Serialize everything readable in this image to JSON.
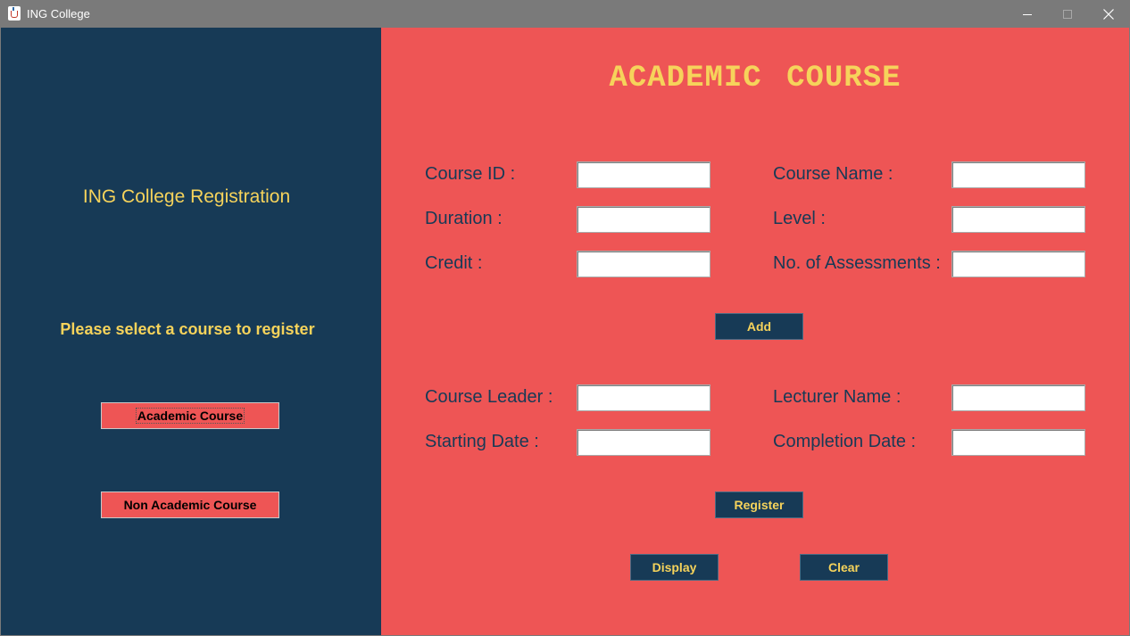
{
  "window": {
    "title": "ING College"
  },
  "sidebar": {
    "title": "ING College Registration",
    "prompt": "Please select a course to register",
    "academic_button": "Academic Course",
    "non_academic_button": "Non Academic Course"
  },
  "form": {
    "heading": "ACADEMIC COURSE",
    "labels": {
      "course_id": "Course ID :",
      "course_name": "Course Name :",
      "duration": "Duration :",
      "level": "Level :",
      "credit": "Credit :",
      "assessments": "No. of Assessments :",
      "course_leader": "Course Leader :",
      "lecturer_name": "Lecturer Name :",
      "starting_date": "Starting Date :",
      "completion_date": "Completion Date :"
    },
    "values": {
      "course_id": "",
      "course_name": "",
      "duration": "",
      "level": "",
      "credit": "",
      "assessments": "",
      "course_leader": "",
      "lecturer_name": "",
      "starting_date": "",
      "completion_date": ""
    },
    "buttons": {
      "add": "Add",
      "register": "Register",
      "display": "Display",
      "clear": "Clear"
    }
  },
  "colors": {
    "sidebar_bg": "#173a56",
    "main_bg": "#ee5555",
    "accent_text": "#f6d35b",
    "titlebar": "#7a7a7a"
  }
}
